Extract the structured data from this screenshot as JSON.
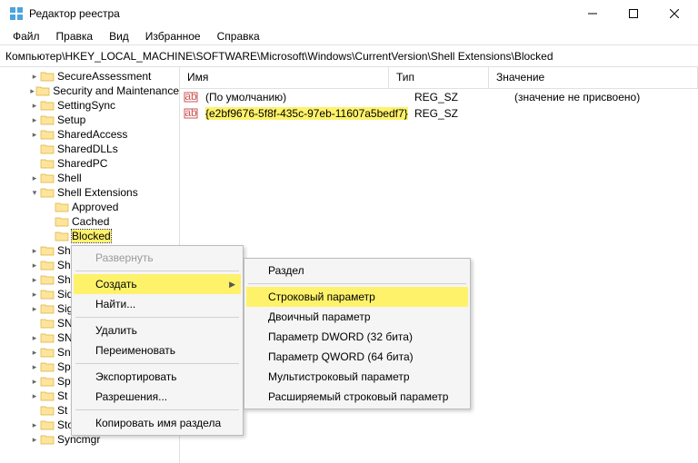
{
  "window": {
    "title": "Редактор реестра"
  },
  "menu": {
    "file": "Файл",
    "edit": "Правка",
    "view": "Вид",
    "favorites": "Избранное",
    "help": "Справка"
  },
  "address": {
    "path": "Компьютер\\HKEY_LOCAL_MACHINE\\SOFTWARE\\Microsoft\\Windows\\CurrentVersion\\Shell Extensions\\Blocked"
  },
  "list_header": {
    "name": "Имя",
    "type": "Тип",
    "value": "Значение"
  },
  "values": [
    {
      "name": "(По умолчанию)",
      "type": "REG_SZ",
      "data": "(значение не присвоено)",
      "highlight": false
    },
    {
      "name": "{e2bf9676-5f8f-435c-97eb-11607a5bedf7}",
      "type": "REG_SZ",
      "data": "",
      "highlight": true
    }
  ],
  "tree": [
    {
      "indent": 2,
      "twisty": ">",
      "label": "SecureAssessment"
    },
    {
      "indent": 2,
      "twisty": ">",
      "label": "Security and Maintenance"
    },
    {
      "indent": 2,
      "twisty": ">",
      "label": "SettingSync"
    },
    {
      "indent": 2,
      "twisty": ">",
      "label": "Setup"
    },
    {
      "indent": 2,
      "twisty": ">",
      "label": "SharedAccess"
    },
    {
      "indent": 2,
      "twisty": "",
      "label": "SharedDLLs"
    },
    {
      "indent": 2,
      "twisty": "",
      "label": "SharedPC"
    },
    {
      "indent": 2,
      "twisty": ">",
      "label": "Shell"
    },
    {
      "indent": 2,
      "twisty": "v",
      "label": "Shell Extensions"
    },
    {
      "indent": 3,
      "twisty": "",
      "label": "Approved"
    },
    {
      "indent": 3,
      "twisty": "",
      "label": "Cached"
    },
    {
      "indent": 3,
      "twisty": "",
      "label": "Blocked",
      "selected": true
    },
    {
      "indent": 2,
      "twisty": ">",
      "label": "Sh"
    },
    {
      "indent": 2,
      "twisty": ">",
      "label": "Sh"
    },
    {
      "indent": 2,
      "twisty": ">",
      "label": "Sh"
    },
    {
      "indent": 2,
      "twisty": ">",
      "label": "Sid"
    },
    {
      "indent": 2,
      "twisty": ">",
      "label": "Sig"
    },
    {
      "indent": 2,
      "twisty": "",
      "label": "SN"
    },
    {
      "indent": 2,
      "twisty": ">",
      "label": "SN"
    },
    {
      "indent": 2,
      "twisty": ">",
      "label": "Sn"
    },
    {
      "indent": 2,
      "twisty": ">",
      "label": "Sp"
    },
    {
      "indent": 2,
      "twisty": ">",
      "label": "Sp"
    },
    {
      "indent": 2,
      "twisty": ">",
      "label": "St"
    },
    {
      "indent": 2,
      "twisty": "",
      "label": "St"
    },
    {
      "indent": 2,
      "twisty": ">",
      "label": "Store"
    },
    {
      "indent": 2,
      "twisty": ">",
      "label": "Syncmgr"
    }
  ],
  "context1": {
    "expand": "Развернуть",
    "new": "Создать",
    "find": "Найти...",
    "delete": "Удалить",
    "rename": "Переименовать",
    "export": "Экспортировать",
    "permissions": "Разрешения...",
    "copy_key": "Копировать имя раздела"
  },
  "context2": {
    "key": "Раздел",
    "string": "Строковый параметр",
    "binary": "Двоичный параметр",
    "dword": "Параметр DWORD (32 бита)",
    "qword": "Параметр QWORD (64 бита)",
    "multi": "Мультистроковый параметр",
    "expand": "Расширяемый строковый параметр"
  }
}
